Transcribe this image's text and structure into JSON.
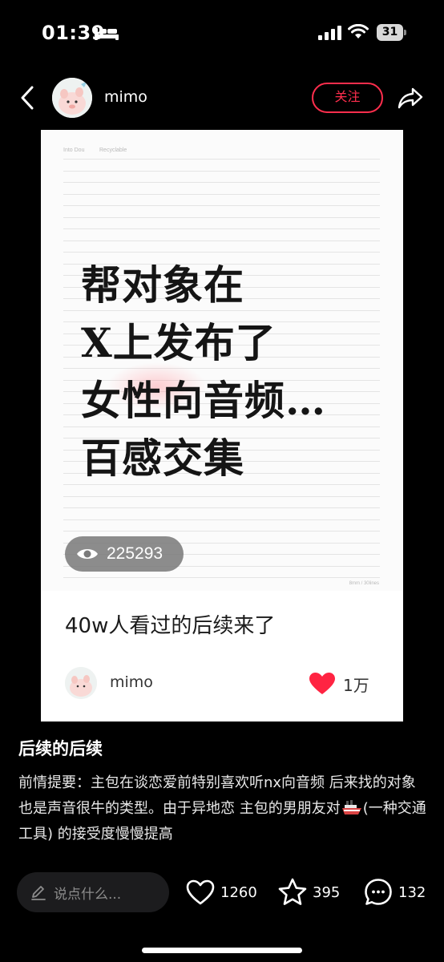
{
  "status_bar": {
    "time": "01:39",
    "battery": "31",
    "icons": [
      "sleep-bed-icon",
      "cellular-signal-icon",
      "wifi-icon",
      "battery-icon"
    ]
  },
  "header": {
    "username": "mimo",
    "follow_label": "关注",
    "icons": [
      "back-chevron-icon",
      "share-icon"
    ],
    "accent_color": "#ff2e4d"
  },
  "post_image": {
    "paper_left_label": "Into Dou",
    "paper_right_label": "Recyclable",
    "paper_footer": "8mm / 30lines",
    "headline_lines": [
      "帮对象在",
      "X上发布了",
      "女性向音频…",
      "百感交集"
    ],
    "views": "225293",
    "card_title": "40w人看过的后续来了",
    "card_author": "mimo",
    "card_likes": "1万"
  },
  "post": {
    "title": "后续的后续",
    "body_part1": "前情提要：主包在谈恋爱前特别喜欢听nx向音频 后来找的对象也是声音很牛的类型。由于异地恋 主包的男朋友对",
    "body_part2": "(一种交通工具) 的接受度慢慢提高"
  },
  "bottom_bar": {
    "comment_placeholder": "说点什么...",
    "likes": "1260",
    "favorites": "395",
    "comments": "132",
    "icons": [
      "pencil-icon",
      "heart-icon",
      "star-icon",
      "comment-bubble-icon"
    ]
  }
}
